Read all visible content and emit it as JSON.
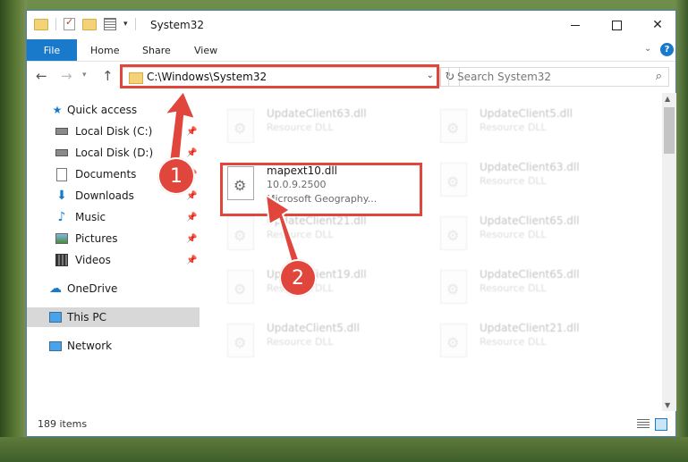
{
  "window": {
    "title": "System32",
    "quick_access_icons": [
      "folder-icon",
      "properties-check-icon",
      "new-folder-icon",
      "customize-arrow-icon"
    ]
  },
  "ribbon": {
    "file_label": "File",
    "tabs": [
      "Home",
      "Share",
      "View"
    ]
  },
  "address_bar": {
    "path": "C:\\Windows\\System32",
    "search_placeholder": "Search System32"
  },
  "sidebar": {
    "items": [
      {
        "label": "Quick access",
        "icon": "star-icon",
        "pinned": false
      },
      {
        "label": "Local Disk (C:)",
        "icon": "drive-icon",
        "pinned": true
      },
      {
        "label": "Local Disk (D:)",
        "icon": "drive-icon",
        "pinned": true
      },
      {
        "label": "Documents",
        "icon": "document-icon",
        "pinned": true
      },
      {
        "label": "Downloads",
        "icon": "download-icon",
        "pinned": true
      },
      {
        "label": "Music",
        "icon": "music-icon",
        "pinned": true
      },
      {
        "label": "Pictures",
        "icon": "pictures-icon",
        "pinned": true
      },
      {
        "label": "Videos",
        "icon": "video-icon",
        "pinned": true
      },
      {
        "label": "OneDrive",
        "icon": "cloud-icon",
        "pinned": false
      },
      {
        "label": "This PC",
        "icon": "computer-icon",
        "pinned": false,
        "selected": true
      },
      {
        "label": "Network",
        "icon": "network-icon",
        "pinned": false
      }
    ]
  },
  "files": {
    "left": [
      {
        "name": "UpdateClient63.dll",
        "type": "Resource DLL"
      },
      {
        "name": "mapext10.dll",
        "version": "10.0.9.2500",
        "description": "Microsoft Geography...",
        "highlighted": true
      },
      {
        "name": "UpdateClient21.dll",
        "type": "Resource DLL"
      },
      {
        "name": "UpdateClient19.dll",
        "type": "Resource DLL"
      },
      {
        "name": "UpdateClient5.dll",
        "type": "Resource DLL"
      }
    ],
    "right": [
      {
        "name": "UpdateClient5.dll",
        "type": "Resource DLL"
      },
      {
        "name": "UpdateClient63.dll",
        "type": "Resource DLL"
      },
      {
        "name": "UpdateClient65.dll",
        "type": "Resource DLL"
      },
      {
        "name": "UpdateClient65.dll",
        "type": "Resource DLL"
      },
      {
        "name": "UpdateClient21.dll",
        "type": "Resource DLL"
      }
    ]
  },
  "status": {
    "item_count": "189 items"
  },
  "annotations": {
    "step1": "1",
    "step2": "2",
    "color": "#e0463c"
  }
}
